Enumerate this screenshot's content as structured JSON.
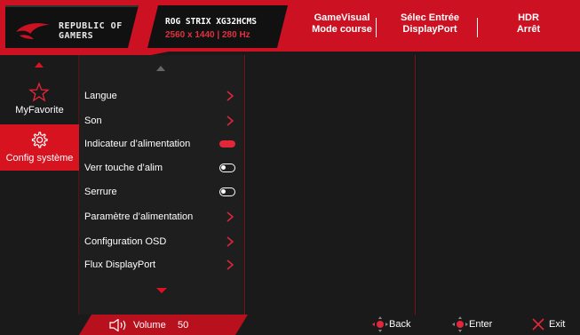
{
  "header": {
    "brand": [
      "REPUBLIC OF",
      "GAMERS"
    ],
    "model": "ROG STRIX XG32HCMS",
    "resolution": "2560 x 1440",
    "refresh": "280 Hz",
    "status": [
      {
        "line1": "GameVisual",
        "line2": "Mode course"
      },
      {
        "line1": "Sélec Entrée",
        "line2": "DisplayPort"
      },
      {
        "line1": "HDR",
        "line2": "Arrêt"
      }
    ]
  },
  "sidebar": {
    "items": [
      {
        "label": "MyFavorite",
        "icon": "star-icon"
      },
      {
        "label": "Config système",
        "icon": "gear-icon"
      }
    ]
  },
  "menu": {
    "items": [
      {
        "label": "Langue",
        "control": "chevron"
      },
      {
        "label": "Son",
        "control": "chevron"
      },
      {
        "label": "Indicateur d’alimentation",
        "control": "pill-on"
      },
      {
        "label": "Verr touche d’alim",
        "control": "toggle-off"
      },
      {
        "label": "Serrure",
        "control": "toggle-off"
      },
      {
        "label": "Paramètre d’alimentation",
        "control": "chevron"
      },
      {
        "label": "Configuration OSD",
        "control": "chevron"
      },
      {
        "label": "Flux DisplayPort",
        "control": "chevron"
      }
    ]
  },
  "footer": {
    "volume_label": "Volume",
    "volume_value": "50",
    "back": "Back",
    "enter": "Enter",
    "exit": "Exit"
  },
  "colors": {
    "accent": "#d7131f",
    "background": "#1a1a1a"
  }
}
